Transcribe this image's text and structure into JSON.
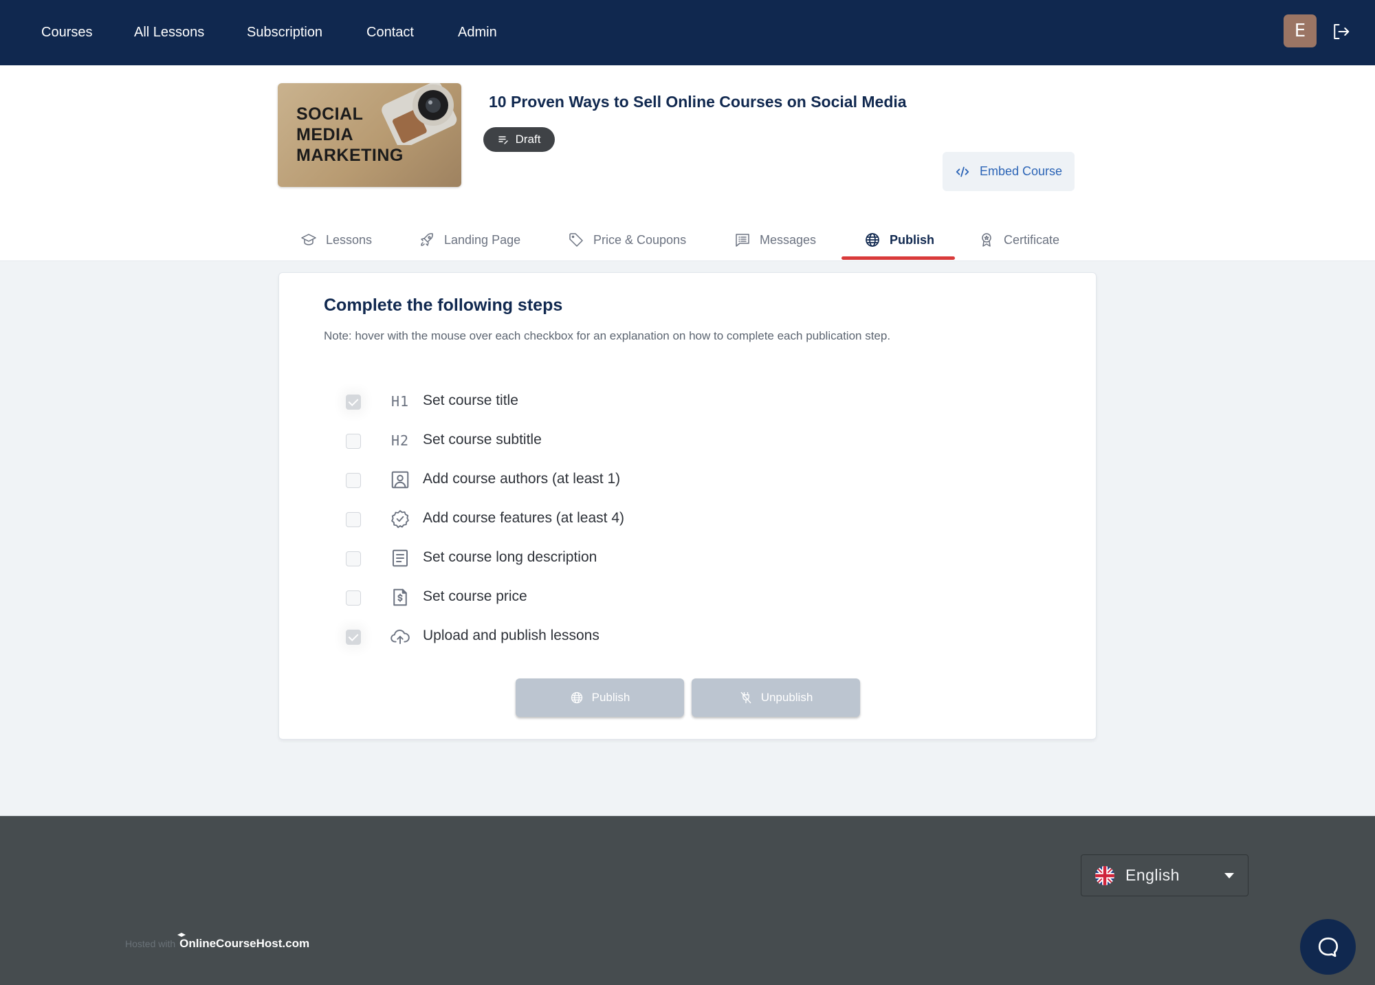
{
  "nav": {
    "items": [
      {
        "label": "Courses"
      },
      {
        "label": "All Lessons"
      },
      {
        "label": "Subscription"
      },
      {
        "label": "Contact"
      },
      {
        "label": "Admin"
      }
    ],
    "avatar_initial": "E",
    "avatar_color": "#9b7564",
    "logout_icon": "logout-icon"
  },
  "course": {
    "title": "10 Proven Ways to Sell Online Courses on Social Media",
    "thumbnail_text": [
      "SOCIAL",
      "MEDIA",
      "MARKETING"
    ],
    "status": "Draft",
    "embed_label": "Embed Course"
  },
  "tabs": [
    {
      "label": "Lessons",
      "icon": "graduation-cap-icon",
      "active": false
    },
    {
      "label": "Landing Page",
      "icon": "rocket-icon",
      "active": false
    },
    {
      "label": "Price & Coupons",
      "icon": "tag-icon",
      "active": false
    },
    {
      "label": "Messages",
      "icon": "message-icon",
      "active": false
    },
    {
      "label": "Publish",
      "icon": "globe-icon",
      "active": true
    },
    {
      "label": "Certificate",
      "icon": "award-icon",
      "active": false
    }
  ],
  "publish": {
    "title": "Complete the following steps",
    "note": "Note: hover with the mouse over each checkbox for an explanation on how to complete each publication step.",
    "steps": [
      {
        "label": "Set course title",
        "icon": "h1-icon",
        "icon_text": "H1",
        "checked": true
      },
      {
        "label": "Set course subtitle",
        "icon": "h2-icon",
        "icon_text": "H2",
        "checked": false
      },
      {
        "label": "Add course authors (at least 1)",
        "icon": "user-square-icon",
        "checked": false
      },
      {
        "label": "Add course features (at least 4)",
        "icon": "badge-check-icon",
        "checked": false
      },
      {
        "label": "Set course long description",
        "icon": "file-text-icon",
        "checked": false
      },
      {
        "label": "Set course price",
        "icon": "file-dollar-icon",
        "checked": false
      },
      {
        "label": "Upload and publish lessons",
        "icon": "cloud-upload-icon",
        "checked": true
      }
    ],
    "publish_label": "Publish",
    "unpublish_label": "Unpublish"
  },
  "footer": {
    "language": "English",
    "hosted_prefix": "Hosted with",
    "hosted_brand": "OnlineCourseHost.com"
  },
  "colors": {
    "nav_bg": "#10284f",
    "accent_underline": "#d93a3a",
    "embed_text": "#2b64b6",
    "footer_bg": "#464c4f",
    "disabled_button": "#bcc5d0"
  }
}
